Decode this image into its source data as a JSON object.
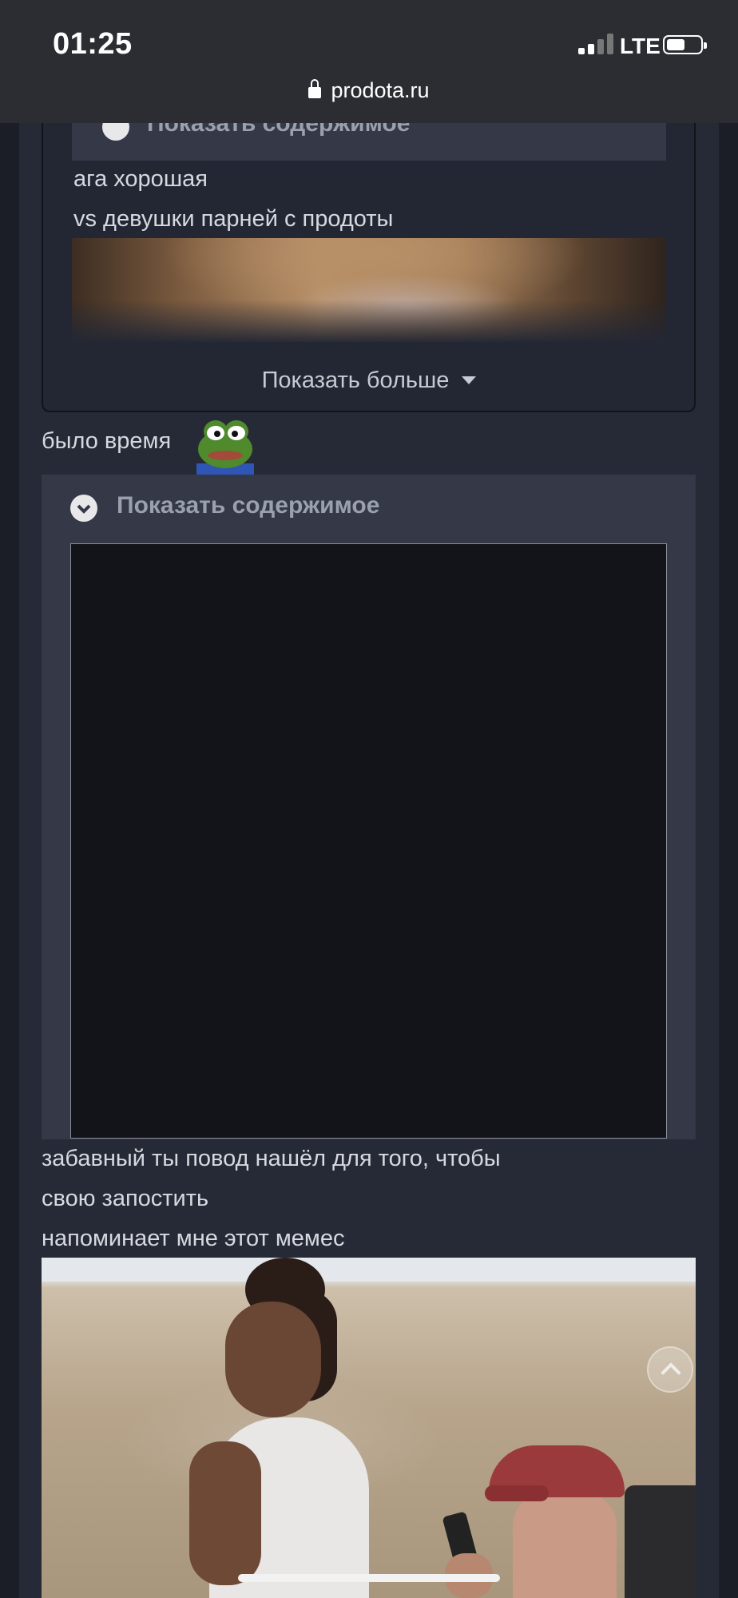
{
  "status_bar": {
    "time": "01:25",
    "network": "LTE"
  },
  "browser": {
    "url": "prodota.ru"
  },
  "quoted_post": {
    "spoiler_label": "Показать содержимое",
    "lines": [
      "ага хорошая",
      "vs девушки парней с продоты"
    ],
    "show_more_label": "Показать больше"
  },
  "post": {
    "line1": "было время",
    "emoji": "pepe-frog",
    "spoiler_label": "Показать содержимое",
    "text_lines": [
      "забавный ты повод нашёл для того, чтобы",
      "свою запостить",
      "напоминает мне этот мемес"
    ]
  },
  "colors": {
    "background": "#1b1e27",
    "post_bg": "#262a36",
    "spoiler_bg": "#343847",
    "text": "#d6d9df"
  }
}
